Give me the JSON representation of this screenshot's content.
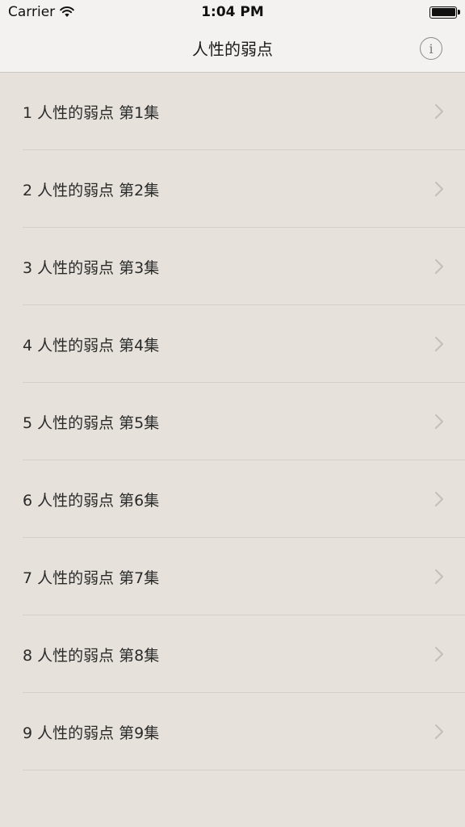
{
  "status_bar": {
    "carrier": "Carrier",
    "time": "1:04 PM"
  },
  "nav": {
    "title": "人性的弱点",
    "info_glyph": "i"
  },
  "episodes": [
    {
      "label": "1 人性的弱点 第1集"
    },
    {
      "label": "2 人性的弱点 第2集"
    },
    {
      "label": "3 人性的弱点 第3集"
    },
    {
      "label": "4 人性的弱点 第4集"
    },
    {
      "label": "5 人性的弱点 第5集"
    },
    {
      "label": "6 人性的弱点 第6集"
    },
    {
      "label": "7 人性的弱点 第7集"
    },
    {
      "label": "8 人性的弱点 第8集"
    },
    {
      "label": "9 人性的弱点 第9集"
    }
  ],
  "icons": {
    "wifi": "wifi-icon",
    "battery": "battery-icon",
    "info": "info-icon",
    "disclosure": "chevron-right-icon"
  },
  "colors": {
    "background": "#e6e2db",
    "bar_background": "#f3f2f0",
    "separator": "#d3cfc8",
    "chevron": "#c4c1bb"
  }
}
